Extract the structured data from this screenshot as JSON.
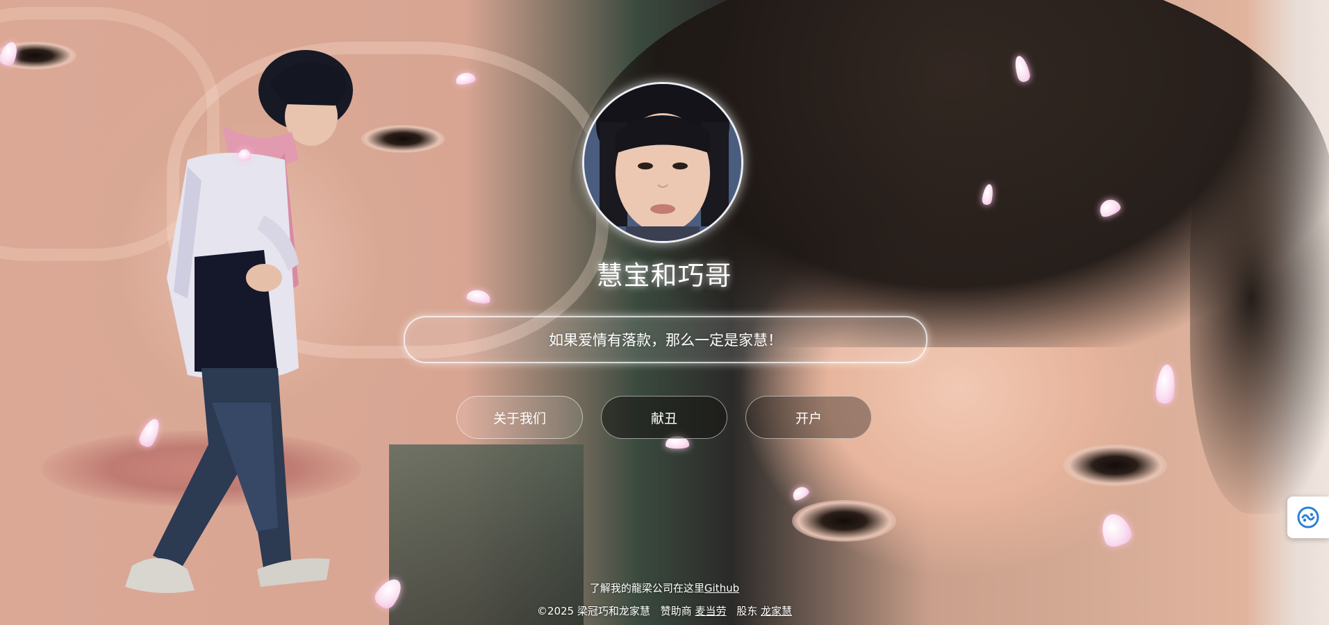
{
  "site": {
    "title": "慧宝和巧哥",
    "slogan": "如果爱情有落款，那么一定是家慧！"
  },
  "nav": {
    "buttons": [
      {
        "label": "关于我们"
      },
      {
        "label": "献丑"
      },
      {
        "label": "开户"
      }
    ]
  },
  "footer": {
    "line1_text": "了解我的龍梁公司在这里",
    "line1_link": "Github",
    "copyright": "©2025 梁冠巧和龙家慧",
    "sponsor_label": "赞助商",
    "sponsor_name": "麦当劳",
    "shareholder_label": "股东",
    "shareholder_name": "龙家慧"
  },
  "icons": {
    "side_widget": "translate-icon"
  },
  "colors": {
    "text": "#ffffff",
    "petal": "#f3b8dc",
    "widget_icon": "#2b7fd8"
  }
}
